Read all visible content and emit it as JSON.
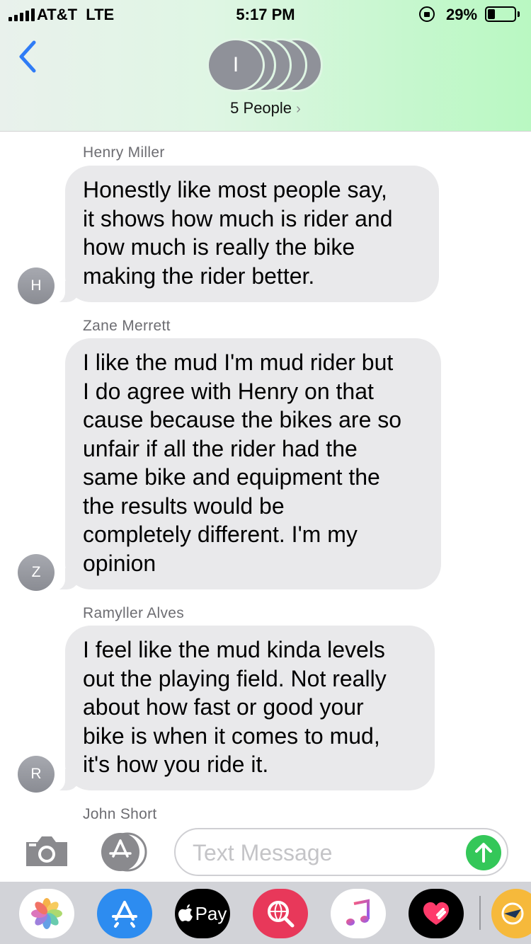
{
  "status_bar": {
    "carrier": "AT&T",
    "network": "LTE",
    "time": "5:17 PM",
    "battery_percent": "29%",
    "battery_level": 0.29
  },
  "header": {
    "group_initial": "I",
    "people_label": "5 People",
    "chevron": "›"
  },
  "messages": [
    {
      "sender": "Henry Miller",
      "initial": "H",
      "lines": [
        "Honestly like most people say,",
        "it shows how much is rider and",
        "how much is really the bike",
        "making the rider better."
      ]
    },
    {
      "sender": "Zane Merrett",
      "initial": "Z",
      "lines": [
        "I like the mud I'm mud rider but",
        "I do agree with Henry on that",
        "cause because the bikes are so",
        "unfair if all the rider had the",
        "same bike and equipment the",
        "the results would be",
        "completely different. I'm my",
        "opinion"
      ]
    },
    {
      "sender": "Ramyller Alves",
      "initial": "R",
      "lines": [
        "I feel like the mud kinda levels",
        "out the playing field. Not really",
        "about how fast or good your",
        "bike is when it comes to mud,",
        "it's how you ride it."
      ]
    },
    {
      "sender": "John Short"
    }
  ],
  "input": {
    "placeholder": "Text Message",
    "value": ""
  },
  "app_drawer": {
    "items": [
      "photos-icon",
      "app-store-icon",
      "apple-pay-icon",
      "web-search-icon",
      "music-icon",
      "digital-touch-icon",
      "partial-app-icon"
    ],
    "apple_pay_label": "Pay"
  },
  "colors": {
    "bubble": "#e9e9eb",
    "send": "#34c759",
    "back_arrow": "#2f7cf6",
    "sender_name": "#6d6d72"
  }
}
